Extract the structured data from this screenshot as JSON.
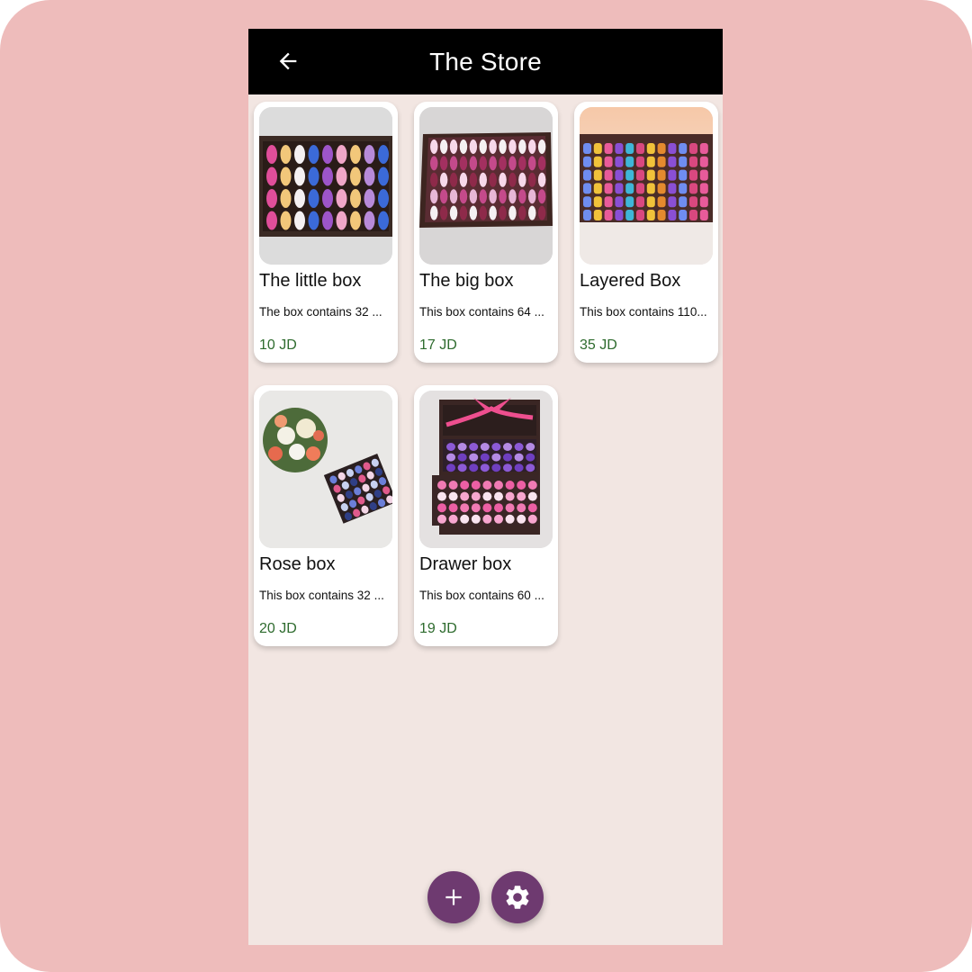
{
  "app": {
    "title": "The Store",
    "frame_color": "#eebcbb",
    "appbar_color": "#000000",
    "background_color": "#f2e6e2",
    "price_color": "#2e6b2e",
    "fab_color": "#6e3a70"
  },
  "header": {
    "back_icon": "arrow-left-icon",
    "title": "The Store"
  },
  "products": [
    {
      "name": "The little box",
      "description": "The box contains 32 ...",
      "price": "10 JD",
      "image": "little-box-photo"
    },
    {
      "name": "The big box",
      "description": "This box contains 64 ...",
      "price": "17 JD",
      "image": "big-box-photo"
    },
    {
      "name": "Layered Box",
      "description": "This box contains 110...",
      "price": "35 JD",
      "image": "layered-box-photo"
    },
    {
      "name": "Rose box",
      "description": "This box contains 32 ...",
      "price": "20 JD",
      "image": "rose-box-photo"
    },
    {
      "name": "Drawer box",
      "description": "This box contains 60 ...",
      "price": "19 JD",
      "image": "drawer-box-photo"
    }
  ],
  "actions": {
    "add_icon": "plus-icon",
    "settings_icon": "gear-icon"
  }
}
